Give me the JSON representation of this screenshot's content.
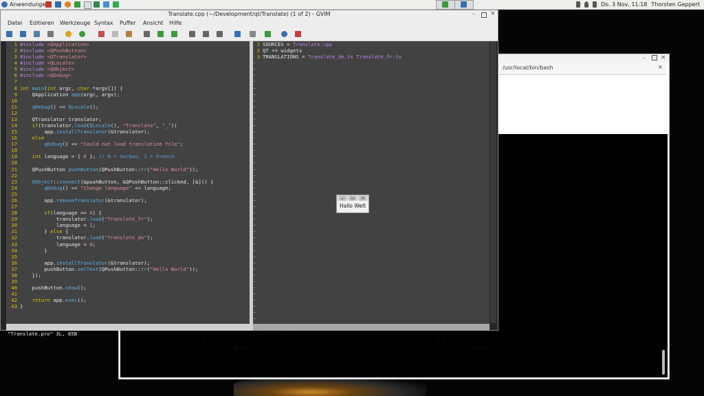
{
  "panel": {
    "menu_label": "Anwendungen",
    "clock": "Do.  3 Nov, 11:18",
    "user": "Thorsten Geppert"
  },
  "gvim": {
    "title": "Translate.cpp (~/Development/qt/Translate) (1 of 2) - GVIM",
    "menu": [
      "Datei",
      "Editieren",
      "Werkzeuge",
      "Syntax",
      "Puffer",
      "Ansicht",
      "Hilfe"
    ],
    "left_status": {
      "file": "Translate.cpp",
      "pos": "1,1",
      "scroll": "Alles"
    },
    "right_status": {
      "file": "Translate.pro",
      "pos": "1,1",
      "scroll": "Alles"
    },
    "cmdline": "\"Translate.pro\" 3L, 85B",
    "right_lines": [
      "SOURCES = Translate.cpp",
      "QT += widgets",
      "TRANSLATIONS = Translate_de.ts Translate_fr.ts"
    ]
  },
  "terminal": {
    "tab_title": "/usr/local/bin/bash",
    "tab_close": "×"
  },
  "dialog": {
    "label": "Hallo Welt"
  },
  "code_lines": [
    "#include <QApplication>",
    "#include <QPushButton>",
    "#include <QTranslator>",
    "#include <QLocale>",
    "#include <QObject>",
    "#include <QDebug>",
    "",
    "int main(int argc, char *argv[]) {",
    "    QApplication app(argc, argv);",
    "",
    "    qDebug() << QLocale();",
    "",
    "    QTranslator translator;",
    "    if(translator.load(QLocale(), \"Translate\", \"_\"))",
    "        app.installTranslator(&translator);",
    "    else",
    "        qDebug() << \"Could not load translation file\";",
    "",
    "    int language = { 0 }; // 0 = German, 1 = French",
    "",
    "    QPushButton pushButton(QPushButton::tr(\"Hello World\"));",
    "",
    "    QObject::connect(&pushButton, &QPushButton::clicked, [&]() {",
    "        qDebug() << \"Change language\" << language;",
    "",
    "        app.removeTranslator(&translator);",
    "",
    "        if(language == 0) {",
    "            translator.load(\"Translate_fr\");",
    "            language = 1;",
    "        } else {",
    "            translator.load(\"Translate_de\");",
    "            language = 0;",
    "        }",
    "",
    "        app.installTranslator(&translator);",
    "        pushButton.setText(QPushButton::tr(\"Hello World\"));",
    "    });",
    "",
    "    pushButton.show();",
    "",
    "    return app.exec();",
    "}"
  ],
  "colors": {
    "line_number": "#d6c200",
    "preprocessor": "#b888e0",
    "function": "#5fb0e0",
    "string": "#e08aa0",
    "comment": "#5f9be0",
    "editor_bg": "#424242"
  }
}
